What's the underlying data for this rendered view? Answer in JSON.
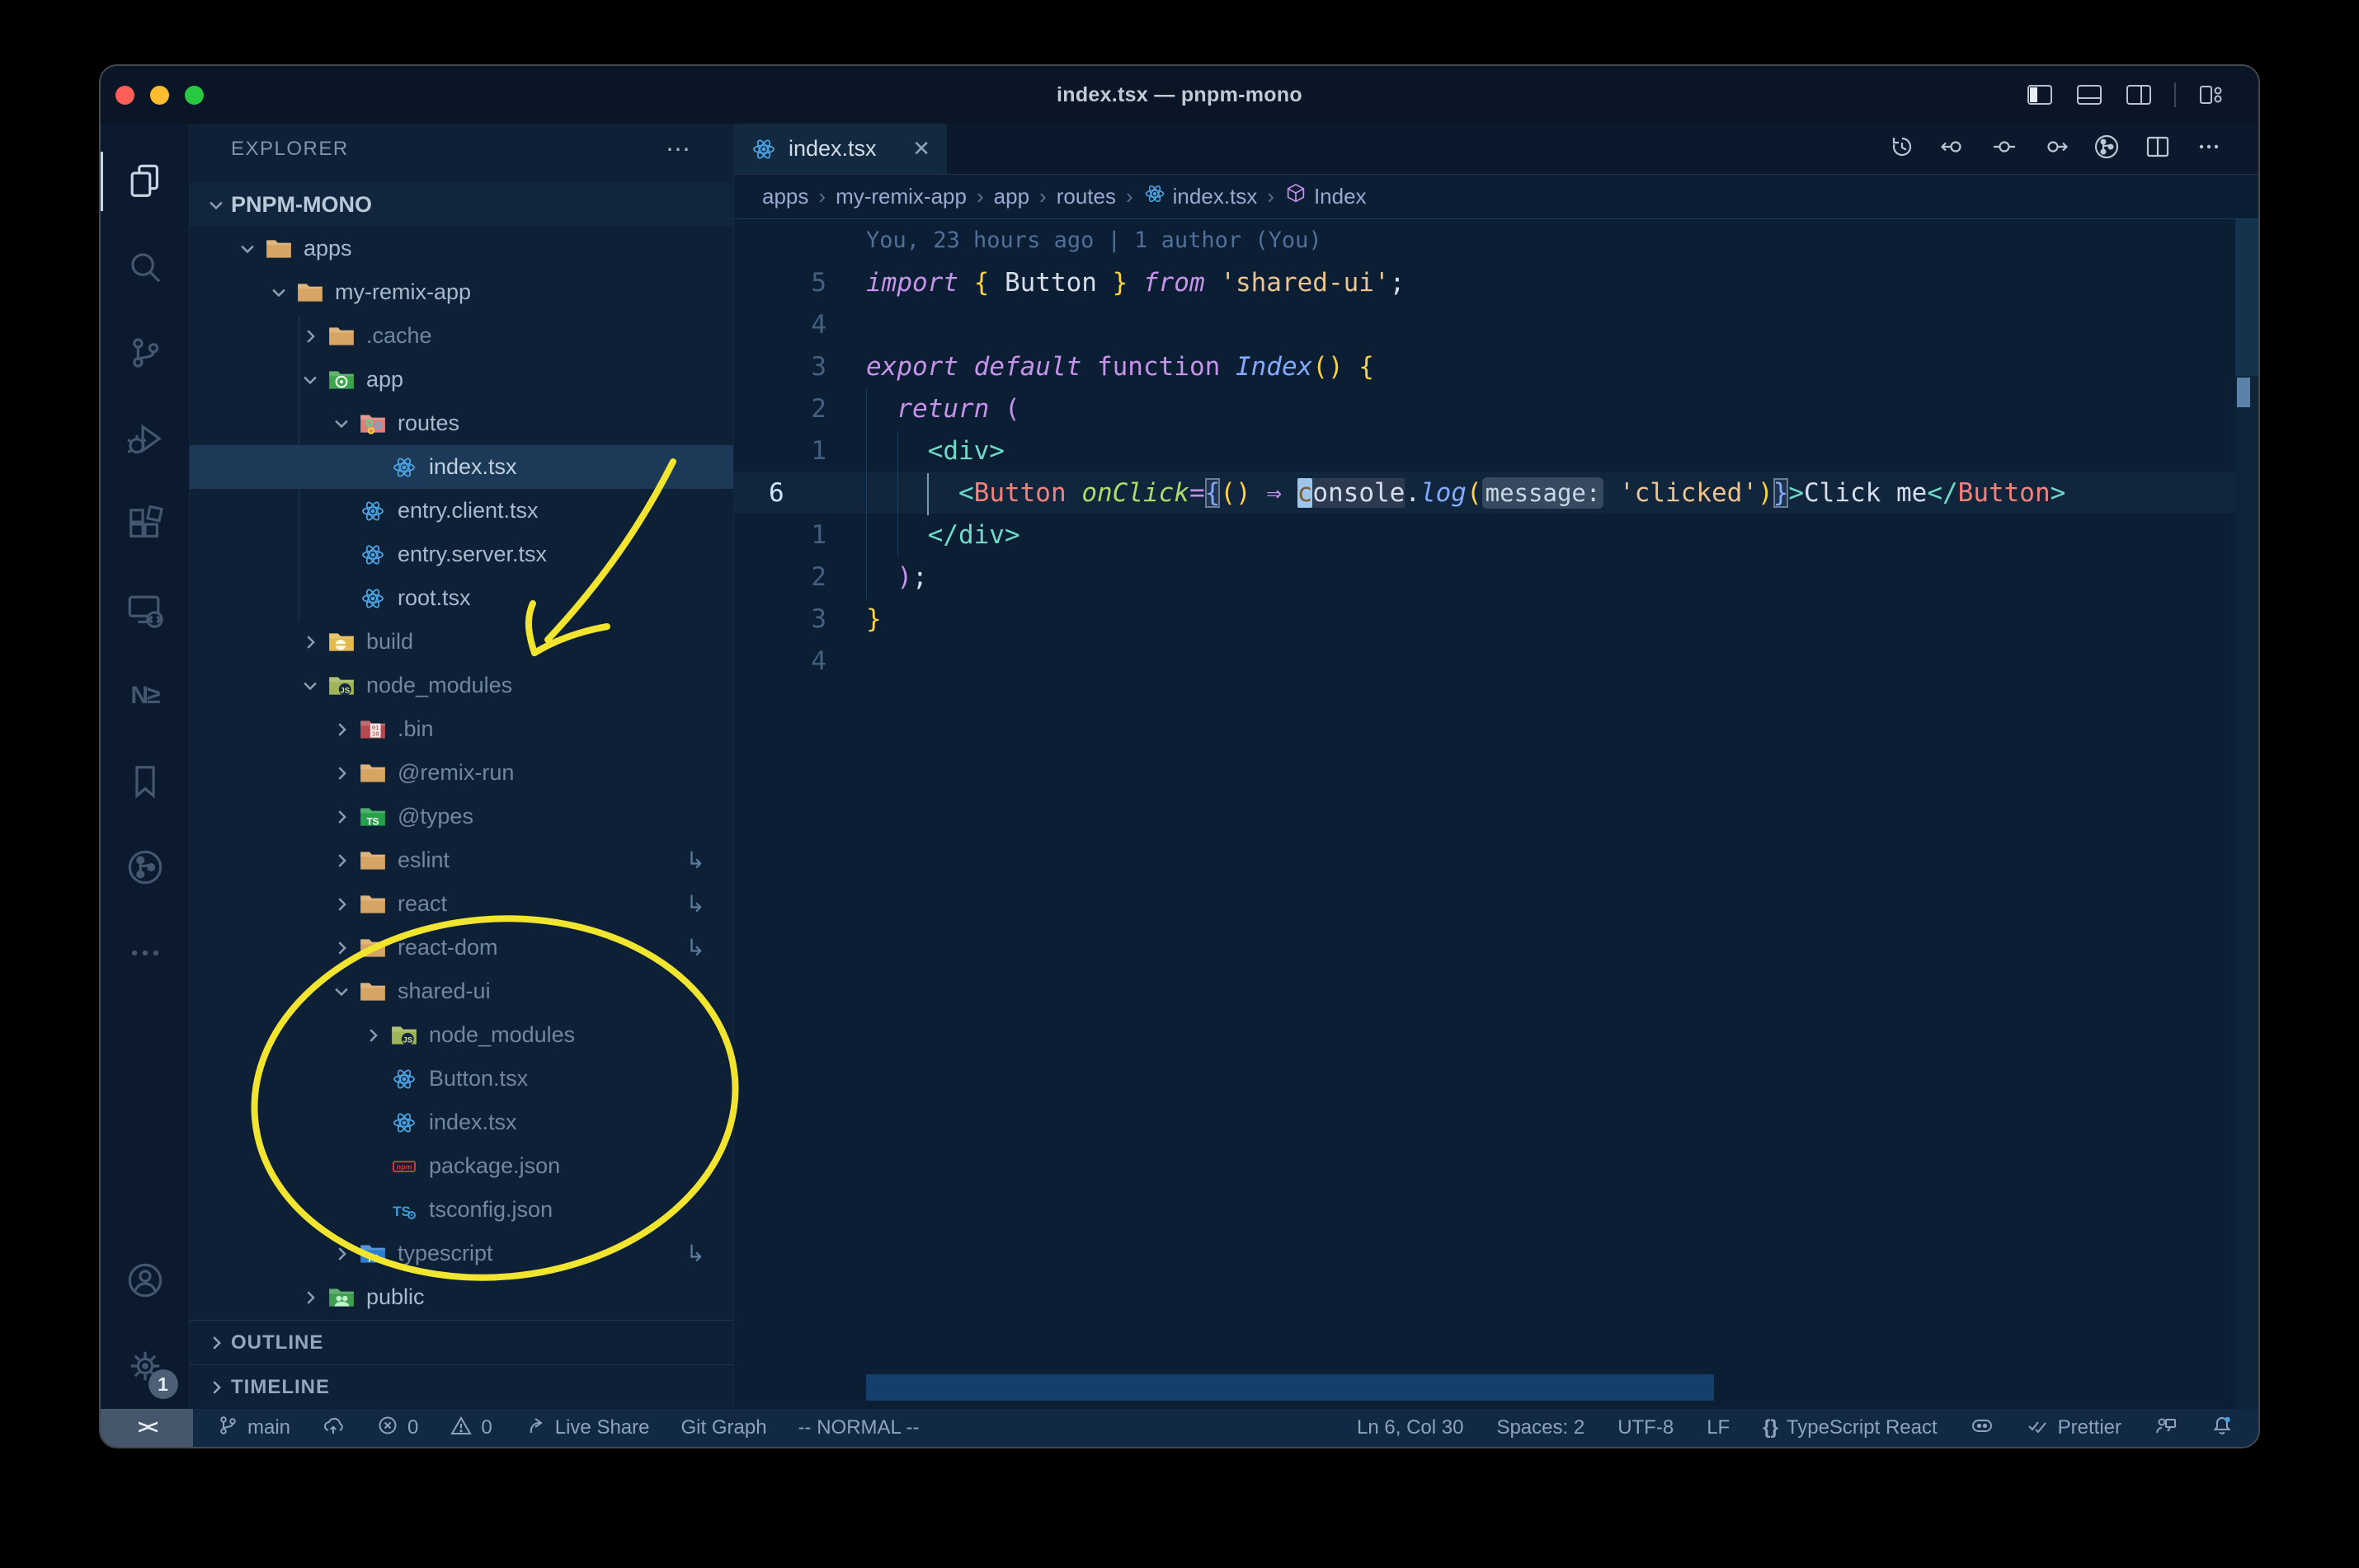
{
  "window": {
    "title": "index.tsx — pnpm-mono"
  },
  "activity_bar": {
    "icons": [
      "explorer",
      "search",
      "source-control",
      "run-debug",
      "extensions",
      "remote-explorer",
      "nx-console",
      "bookmarks",
      "git-graph",
      "more"
    ],
    "bottom_icons": [
      "account",
      "settings"
    ],
    "settings_badge": "1"
  },
  "sidebar": {
    "header": "EXPLORER",
    "more": "⋯",
    "tree": [
      {
        "label": "PNPM-MONO",
        "type": "root",
        "chevron": "down",
        "level": 0
      },
      {
        "label": "apps",
        "icon": "folder-tan",
        "chevron": "down",
        "level": 1
      },
      {
        "label": "my-remix-app",
        "icon": "folder-tan",
        "chevron": "down",
        "level": 2
      },
      {
        "label": ".cache",
        "icon": "folder-tan",
        "chevron": "right",
        "level": 3,
        "dim": true
      },
      {
        "label": "app",
        "icon": "folder-app",
        "chevron": "down",
        "level": 3
      },
      {
        "label": "routes",
        "icon": "folder-routes",
        "chevron": "down",
        "level": 4
      },
      {
        "label": "index.tsx",
        "icon": "react",
        "level": 5,
        "selected": true
      },
      {
        "label": "entry.client.tsx",
        "icon": "react",
        "level": 4
      },
      {
        "label": "entry.server.tsx",
        "icon": "react",
        "level": 4
      },
      {
        "label": "root.tsx",
        "icon": "react",
        "level": 4
      },
      {
        "label": "build",
        "icon": "folder-build",
        "chevron": "right",
        "level": 3,
        "dim": true
      },
      {
        "label": "node_modules",
        "icon": "folder-nm",
        "chevron": "down",
        "level": 3,
        "dim": true
      },
      {
        "label": ".bin",
        "icon": "folder-bin",
        "chevron": "right",
        "level": 4,
        "dim": true
      },
      {
        "label": "@remix-run",
        "icon": "folder-tan",
        "chevron": "right",
        "level": 4,
        "dim": true
      },
      {
        "label": "@types",
        "icon": "folder-types",
        "chevron": "right",
        "level": 4,
        "dim": true
      },
      {
        "label": "eslint",
        "icon": "folder-tan",
        "chevron": "right",
        "level": 4,
        "dim": true,
        "symlink": true
      },
      {
        "label": "react",
        "icon": "folder-tan",
        "chevron": "right",
        "level": 4,
        "dim": true,
        "symlink": true
      },
      {
        "label": "react-dom",
        "icon": "folder-tan",
        "chevron": "right",
        "level": 4,
        "dim": true,
        "symlink": true
      },
      {
        "label": "shared-ui",
        "icon": "folder-tan",
        "chevron": "down",
        "level": 4,
        "dim": true
      },
      {
        "label": "node_modules",
        "icon": "folder-nm",
        "chevron": "right",
        "level": 5,
        "dim": true
      },
      {
        "label": "Button.tsx",
        "icon": "react",
        "level": 5,
        "dim": true
      },
      {
        "label": "index.tsx",
        "icon": "react",
        "level": 5,
        "dim": true
      },
      {
        "label": "package.json",
        "icon": "npm",
        "level": 5,
        "dim": true
      },
      {
        "label": "tsconfig.json",
        "icon": "tsconfig",
        "level": 5,
        "dim": true
      },
      {
        "label": "typescript",
        "icon": "folder-ts",
        "chevron": "right",
        "level": 4,
        "dim": true,
        "symlink": true
      },
      {
        "label": "public",
        "icon": "folder-public",
        "chevron": "right",
        "level": 3
      }
    ],
    "outline": "OUTLINE",
    "timeline": "TIMELINE"
  },
  "editor": {
    "tab": {
      "label": "index.tsx",
      "icon": "react",
      "close": "✕"
    },
    "breadcrumbs": [
      {
        "label": "apps"
      },
      {
        "label": "my-remix-app"
      },
      {
        "label": "app"
      },
      {
        "label": "routes"
      },
      {
        "label": "index.tsx",
        "icon": "react"
      },
      {
        "label": "Index",
        "icon": "symbol-module"
      }
    ],
    "blame": "You, 23 hours ago | 1 author (You)",
    "code_lines": [
      {
        "num": "5",
        "segments": [
          {
            "c": "kwi",
            "t": "import"
          },
          {
            "c": "w",
            "t": " "
          },
          {
            "c": "y",
            "t": "{"
          },
          {
            "c": "w",
            "t": " Button "
          },
          {
            "c": "y",
            "t": "}"
          },
          {
            "c": "w",
            "t": " "
          },
          {
            "c": "kwi",
            "t": "from"
          },
          {
            "c": "w",
            "t": " "
          },
          {
            "c": "str",
            "t": "'shared-ui'"
          },
          {
            "c": "w",
            "t": ";"
          }
        ]
      },
      {
        "num": "4",
        "segments": []
      },
      {
        "num": "3",
        "segments": [
          {
            "c": "kwi",
            "t": "export"
          },
          {
            "c": "w",
            "t": " "
          },
          {
            "c": "kwi",
            "t": "default"
          },
          {
            "c": "w",
            "t": " "
          },
          {
            "c": "kw",
            "t": "function"
          },
          {
            "c": "w",
            "t": " "
          },
          {
            "c": "fni",
            "t": "Index"
          },
          {
            "c": "y",
            "t": "()"
          },
          {
            "c": "w",
            "t": " "
          },
          {
            "c": "y",
            "t": "{"
          }
        ]
      },
      {
        "num": "2",
        "segments": [
          {
            "c": "w",
            "t": "  "
          },
          {
            "c": "kwi",
            "t": "return"
          },
          {
            "c": "w",
            "t": " "
          },
          {
            "c": "pink",
            "t": "("
          }
        ]
      },
      {
        "num": "1",
        "segments": [
          {
            "c": "w",
            "t": "    "
          },
          {
            "c": "teal",
            "t": "<div>"
          }
        ]
      },
      {
        "num": "6",
        "current": true,
        "segments": [
          {
            "c": "w",
            "t": "      "
          },
          {
            "c": "teal",
            "t": "<"
          },
          {
            "c": "comp",
            "t": "Button"
          },
          {
            "c": "w",
            "t": " "
          },
          {
            "c": "attr",
            "t": "onClick"
          },
          {
            "c": "pink",
            "t": "="
          },
          {
            "c": "blue bracketbox",
            "t": "{"
          },
          {
            "c": "y",
            "t": "()"
          },
          {
            "c": "w",
            "t": " "
          },
          {
            "c": "pink",
            "t": "⇒"
          },
          {
            "c": "w",
            "t": " "
          },
          {
            "c": "cursor",
            "t": "c"
          },
          {
            "c": "w whl",
            "t": "onsole"
          },
          {
            "c": "w",
            "t": "."
          },
          {
            "c": "fni",
            "t": "log"
          },
          {
            "c": "y",
            "t": "("
          },
          {
            "c": "inlay",
            "t": "message:"
          },
          {
            "c": "w",
            "t": " "
          },
          {
            "c": "str",
            "t": "'clicked'"
          },
          {
            "c": "y",
            "t": ")"
          },
          {
            "c": "blue bracketbox",
            "t": "}"
          },
          {
            "c": "teal",
            "t": ">"
          },
          {
            "c": "w",
            "t": "Click me"
          },
          {
            "c": "teal",
            "t": "</"
          },
          {
            "c": "comp",
            "t": "Button"
          },
          {
            "c": "teal",
            "t": ">"
          }
        ]
      },
      {
        "num": "1",
        "segments": [
          {
            "c": "w",
            "t": "    "
          },
          {
            "c": "teal",
            "t": "</div>"
          }
        ]
      },
      {
        "num": "2",
        "segments": [
          {
            "c": "w",
            "t": "  "
          },
          {
            "c": "pink",
            "t": ")"
          },
          {
            "c": "w",
            "t": ";"
          }
        ]
      },
      {
        "num": "3",
        "segments": [
          {
            "c": "y",
            "t": "}"
          }
        ]
      },
      {
        "num": "4",
        "segments": []
      }
    ]
  },
  "status_bar": {
    "left": [
      {
        "icon": "branch",
        "label": "main"
      },
      {
        "icon": "cloud-upload",
        "label": ""
      },
      {
        "icon": "error",
        "label": "0"
      },
      {
        "icon": "warning",
        "label": "0"
      },
      {
        "icon": "live-share",
        "label": "Live Share"
      },
      {
        "label": "Git Graph"
      },
      {
        "label": "-- NORMAL --"
      }
    ],
    "right": [
      {
        "label": "Ln 6, Col 30"
      },
      {
        "label": "Spaces: 2"
      },
      {
        "label": "UTF-8"
      },
      {
        "label": "LF"
      },
      {
        "icon": "braces",
        "label": "TypeScript React"
      },
      {
        "icon": "copilot",
        "label": ""
      },
      {
        "icon": "double-check",
        "label": "Prettier"
      },
      {
        "icon": "feedback",
        "label": ""
      },
      {
        "icon": "bell-dot",
        "label": ""
      }
    ],
    "remote_glyph": "><"
  },
  "annotations": {
    "color": "#f2e530",
    "shapes": [
      "hand-drawn-arrow",
      "hand-drawn-ellipse"
    ]
  },
  "colors": {
    "editor_bg": "#0b1e33",
    "sidebar_bg": "#0d2036",
    "statusbar_bg": "#112944",
    "selection_row": "#1c3a57",
    "keyword": "#c792ea",
    "string": "#ecc48d",
    "tag": "#f5827a",
    "brace": "#ffd23f",
    "annotation": "#f2e530"
  }
}
